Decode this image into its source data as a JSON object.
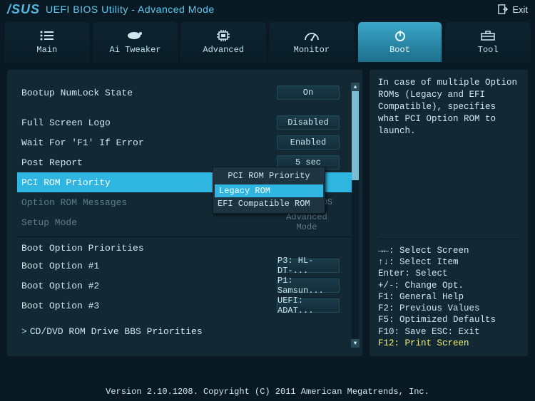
{
  "header": {
    "brand": "/SUS",
    "title": "UEFI BIOS Utility - Advanced Mode",
    "exit": "Exit"
  },
  "tabs": [
    "Main",
    "Ai Tweaker",
    "Advanced",
    "Monitor",
    "Boot",
    "Tool"
  ],
  "active_tab": 4,
  "settings": [
    {
      "label": "Bootup NumLock State",
      "value": "On"
    },
    {
      "label": "Full Screen Logo",
      "value": "Disabled"
    },
    {
      "label": "Wait For 'F1' If Error",
      "value": "Enabled"
    },
    {
      "label": "Post Report",
      "value": "5 sec"
    },
    {
      "label": "PCI ROM Priority",
      "value": "Legacy ROM",
      "selected": true
    },
    {
      "label": "Option ROM Messages",
      "value": "Force BIOS",
      "dimmed": true
    },
    {
      "label": "Setup Mode",
      "value": "Advanced Mode",
      "dimmed": true
    }
  ],
  "priorities_heading": "Boot Option Priorities",
  "boot_options": [
    {
      "label": "Boot Option #1",
      "value": "P3: HL-DT-..."
    },
    {
      "label": "Boot Option #2",
      "value": "P1: Samsun..."
    },
    {
      "label": "Boot Option #3",
      "value": "UEFI: ADAT..."
    }
  ],
  "subentry": {
    "chev": ">",
    "label": "CD/DVD ROM Drive BBS Priorities"
  },
  "popup": {
    "title": "PCI ROM Priority",
    "items": [
      "Legacy ROM",
      "EFI Compatible ROM"
    ],
    "selected": 0
  },
  "help": "In case of multiple Option ROMs (Legacy and EFI Compatible), specifies what PCI Option ROM to launch.",
  "keys": [
    "→←: Select Screen",
    "↑↓: Select Item",
    "Enter: Select",
    "+/-: Change Opt.",
    "F1: General Help",
    "F2: Previous Values",
    "F5: Optimized Defaults",
    "F10: Save   ESC: Exit",
    "F12: Print Screen"
  ],
  "keys_highlight_index": 8,
  "footer": "Version 2.10.1208. Copyright (C) 2011 American Megatrends, Inc."
}
